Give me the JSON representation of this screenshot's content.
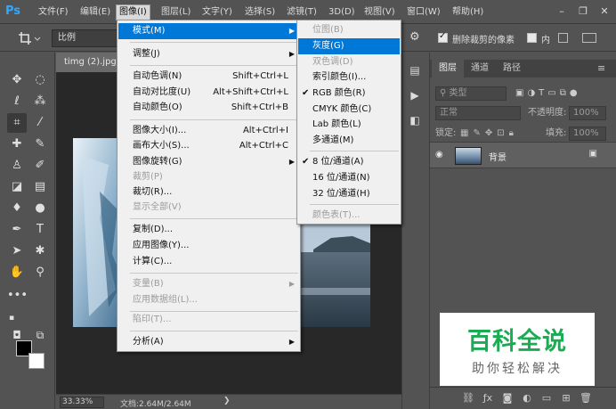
{
  "menubar": {
    "logo": "Ps",
    "items": [
      "文件(F)",
      "编辑(E)",
      "图像(I)",
      "图层(L)",
      "文字(Y)",
      "选择(S)",
      "滤镜(T)",
      "3D(D)",
      "视图(V)",
      "窗口(W)",
      "帮助(H)"
    ],
    "active_index": 2,
    "window_controls": [
      "minimize",
      "restore",
      "close"
    ]
  },
  "options": {
    "ratio": "比例",
    "delete_cropped_label": "删除裁剪的像素",
    "delete_cropped_checked": true,
    "content_aware_label": "内",
    "content_aware_checked": false
  },
  "document": {
    "tab_title": "timg (2).jpg",
    "zoom": "33.33%",
    "doc_size": "文档:2.64M/2.64M",
    "status_arrow": "❯"
  },
  "image_menu": {
    "items": [
      {
        "label": "模式(M)",
        "shortcut": "",
        "submenu": true,
        "highlighted": true,
        "disabled": false
      },
      {
        "separator": true
      },
      {
        "label": "调整(J)",
        "shortcut": "",
        "submenu": true,
        "highlighted": false,
        "disabled": false
      },
      {
        "separator": true
      },
      {
        "label": "自动色调(N)",
        "shortcut": "Shift+Ctrl+L",
        "submenu": false,
        "highlighted": false,
        "disabled": false
      },
      {
        "label": "自动对比度(U)",
        "shortcut": "Alt+Shift+Ctrl+L",
        "submenu": false,
        "highlighted": false,
        "disabled": false
      },
      {
        "label": "自动颜色(O)",
        "shortcut": "Shift+Ctrl+B",
        "submenu": false,
        "highlighted": false,
        "disabled": false
      },
      {
        "separator": true
      },
      {
        "label": "图像大小(I)...",
        "shortcut": "Alt+Ctrl+I",
        "submenu": false,
        "highlighted": false,
        "disabled": false
      },
      {
        "label": "画布大小(S)...",
        "shortcut": "Alt+Ctrl+C",
        "submenu": false,
        "highlighted": false,
        "disabled": false
      },
      {
        "label": "图像旋转(G)",
        "shortcut": "",
        "submenu": true,
        "highlighted": false,
        "disabled": false
      },
      {
        "label": "裁剪(P)",
        "shortcut": "",
        "submenu": false,
        "highlighted": false,
        "disabled": true
      },
      {
        "label": "裁切(R)...",
        "shortcut": "",
        "submenu": false,
        "highlighted": false,
        "disabled": false
      },
      {
        "label": "显示全部(V)",
        "shortcut": "",
        "submenu": false,
        "highlighted": false,
        "disabled": true
      },
      {
        "separator": true
      },
      {
        "label": "复制(D)...",
        "shortcut": "",
        "submenu": false,
        "highlighted": false,
        "disabled": false
      },
      {
        "label": "应用图像(Y)...",
        "shortcut": "",
        "submenu": false,
        "highlighted": false,
        "disabled": false
      },
      {
        "label": "计算(C)...",
        "shortcut": "",
        "submenu": false,
        "highlighted": false,
        "disabled": false
      },
      {
        "separator": true
      },
      {
        "label": "变量(B)",
        "shortcut": "",
        "submenu": true,
        "highlighted": false,
        "disabled": true
      },
      {
        "label": "应用数据组(L)...",
        "shortcut": "",
        "submenu": false,
        "highlighted": false,
        "disabled": true
      },
      {
        "separator": true
      },
      {
        "label": "陷印(T)...",
        "shortcut": "",
        "submenu": false,
        "highlighted": false,
        "disabled": true
      },
      {
        "separator": true
      },
      {
        "label": "分析(A)",
        "shortcut": "",
        "submenu": true,
        "highlighted": false,
        "disabled": false
      }
    ]
  },
  "mode_submenu": {
    "items": [
      {
        "label": "位图(B)",
        "checked": false,
        "highlighted": false,
        "disabled": true
      },
      {
        "label": "灰度(G)",
        "checked": false,
        "highlighted": true,
        "disabled": false
      },
      {
        "label": "双色调(D)",
        "checked": false,
        "highlighted": false,
        "disabled": true
      },
      {
        "label": "索引颜色(I)...",
        "checked": false,
        "highlighted": false,
        "disabled": false
      },
      {
        "label": "RGB 颜色(R)",
        "checked": true,
        "highlighted": false,
        "disabled": false
      },
      {
        "label": "CMYK 颜色(C)",
        "checked": false,
        "highlighted": false,
        "disabled": false
      },
      {
        "label": "Lab 颜色(L)",
        "checked": false,
        "highlighted": false,
        "disabled": false
      },
      {
        "label": "多通道(M)",
        "checked": false,
        "highlighted": false,
        "disabled": false
      },
      {
        "separator": true
      },
      {
        "label": "8 位/通道(A)",
        "checked": true,
        "highlighted": false,
        "disabled": false
      },
      {
        "label": "16 位/通道(N)",
        "checked": false,
        "highlighted": false,
        "disabled": false
      },
      {
        "label": "32 位/通道(H)",
        "checked": false,
        "highlighted": false,
        "disabled": false
      },
      {
        "separator": true
      },
      {
        "label": "颜色表(T)...",
        "checked": false,
        "highlighted": false,
        "disabled": true
      }
    ]
  },
  "layers_panel": {
    "tabs": [
      "图层",
      "通道",
      "路径"
    ],
    "active_tab": 0,
    "kind_filter": "类型",
    "blend_mode": "正常",
    "opacity_label": "不透明度:",
    "opacity_value": "100%",
    "lock_label": "锁定:",
    "fill_label": "填充:",
    "fill_value": "100%",
    "layer_name": "背景"
  },
  "watermark": {
    "title": "百科全说",
    "subtitle": "助你轻松解决"
  },
  "colors": {
    "highlight": "#0078d7",
    "ui_bg": "#535353",
    "canvas_bg": "#282828",
    "watermark_green": "#1bab53"
  }
}
